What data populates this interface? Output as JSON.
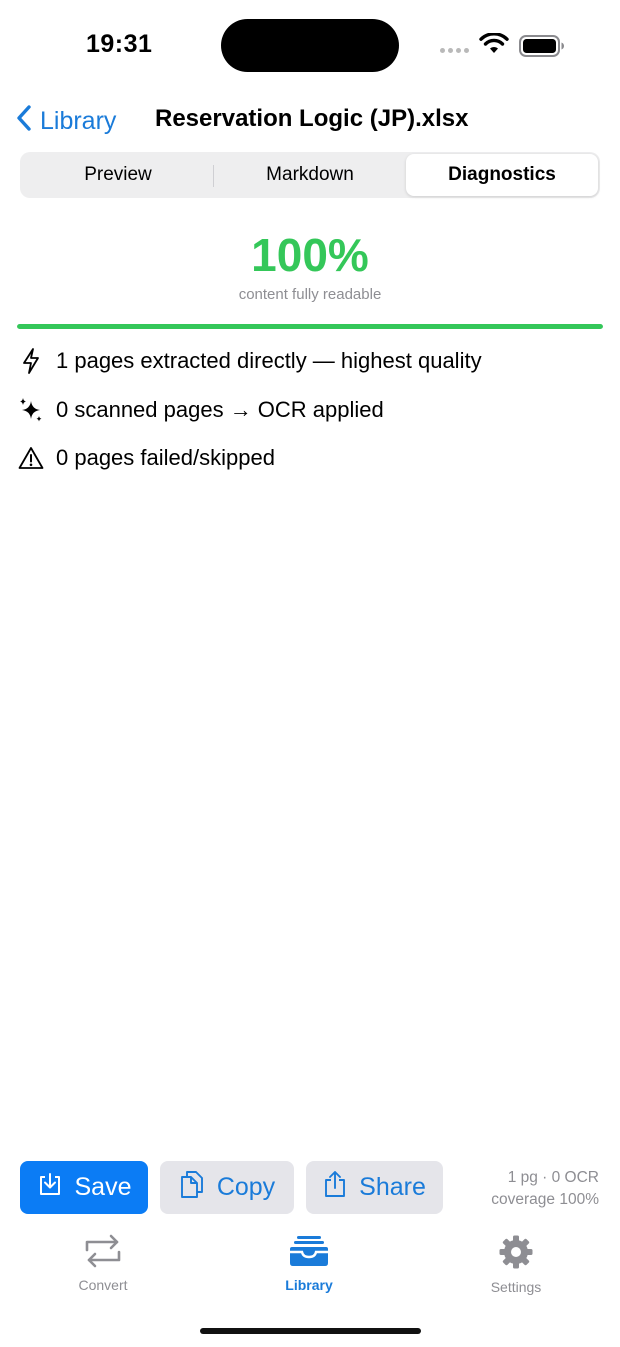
{
  "status_bar": {
    "time": "19:31"
  },
  "nav": {
    "back_label": "Library",
    "title": "Reservation Logic (JP).xlsx"
  },
  "segments": [
    {
      "label": "Preview",
      "active": false
    },
    {
      "label": "Markdown",
      "active": false
    },
    {
      "label": "Diagnostics",
      "active": true
    }
  ],
  "diagnostics": {
    "score": "100%",
    "score_caption": "content fully readable",
    "readable_fraction": 1.0,
    "accent_color": "#34c759",
    "stats": [
      {
        "icon": "lightning-bolt-icon",
        "text": "1 pages extracted directly — highest quality"
      },
      {
        "icon": "sparkles-icon",
        "text": "0 scanned pages → OCR applied"
      },
      {
        "icon": "warning-triangle-icon",
        "text": "0 pages failed/skipped"
      }
    ]
  },
  "actions": {
    "save_label": "Save",
    "copy_label": "Copy",
    "share_label": "Share",
    "meta_line1": "1 pg · 0 OCR",
    "meta_line2": "coverage 100%",
    "primary_color": "#0b7cf5"
  },
  "tabs": [
    {
      "label": "Convert",
      "icon": "convert-icon",
      "active": false
    },
    {
      "label": "Library",
      "icon": "library-tray-icon",
      "active": true
    },
    {
      "label": "Settings",
      "icon": "gear-icon",
      "active": false
    }
  ]
}
